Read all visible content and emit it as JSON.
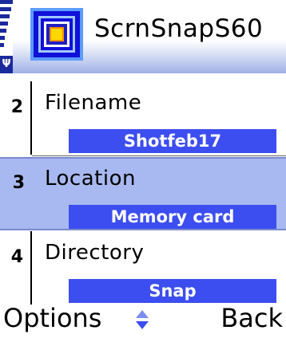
{
  "app": {
    "title": "ScrnSnapS60",
    "icon": "scrnsnap-app-icon",
    "signal_icon": "signal-antenna-icon"
  },
  "list": {
    "items": [
      {
        "number": "2",
        "label": "Filename",
        "value": "Shotfeb17",
        "selected": false
      },
      {
        "number": "3",
        "label": "Location",
        "value": "Memory card",
        "selected": true
      },
      {
        "number": "4",
        "label": "Directory",
        "value": "Snap",
        "selected": false
      }
    ]
  },
  "softkeys": {
    "left": "Options",
    "right": "Back",
    "nav_icon": "scroll-up-down-icon"
  },
  "colors": {
    "value_bar": "#3c4ef0",
    "selected_row": "#a8b8f0",
    "signal": "#1a2a9c"
  }
}
